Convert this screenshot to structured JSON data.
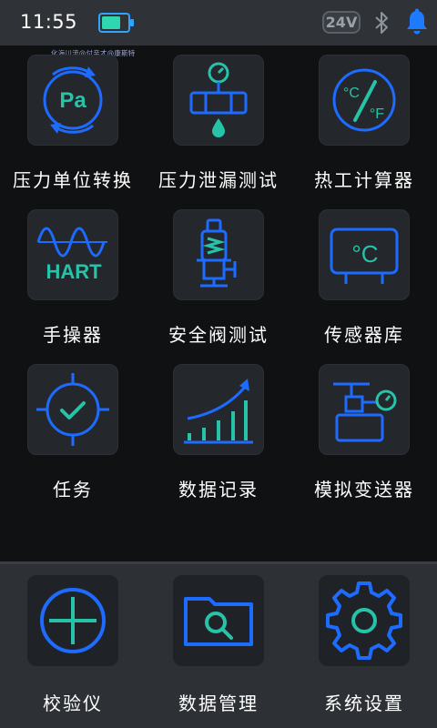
{
  "status_bar": {
    "time": "11:55",
    "voltage": "24V",
    "battery_icon": "battery-icon",
    "bluetooth_icon": "bluetooth-icon",
    "notification_icon": "bell-icon"
  },
  "watermark": "化海川流@付亲才@康斯特",
  "grid": [
    {
      "label": "压力单位转换",
      "icon": "pressure-unit-icon",
      "icon_text": "Pa"
    },
    {
      "label": "压力泄漏测试",
      "icon": "leak-test-icon"
    },
    {
      "label": "热工计算器",
      "icon": "thermal-calculator-icon",
      "icon_text_a": "°C",
      "icon_text_b": "°F"
    },
    {
      "label": "手操器",
      "icon": "hart-communicator-icon",
      "icon_text": "HART"
    },
    {
      "label": "安全阀测试",
      "icon": "safety-valve-icon"
    },
    {
      "label": "传感器库",
      "icon": "sensor-library-icon",
      "icon_text": "°C"
    },
    {
      "label": "任务",
      "icon": "task-icon"
    },
    {
      "label": "数据记录",
      "icon": "data-log-icon"
    },
    {
      "label": "模拟变送器",
      "icon": "simulated-transmitter-icon"
    }
  ],
  "dock": [
    {
      "label": "校验仪",
      "icon": "calibrator-icon"
    },
    {
      "label": "数据管理",
      "icon": "data-management-icon"
    },
    {
      "label": "系统设置",
      "icon": "system-settings-icon"
    }
  ],
  "colors": {
    "accent_blue": "#1e6bff",
    "accent_cyan": "#27c3a8",
    "battery_green": "#2fd6b0",
    "bell_blue": "#1e7bff"
  }
}
